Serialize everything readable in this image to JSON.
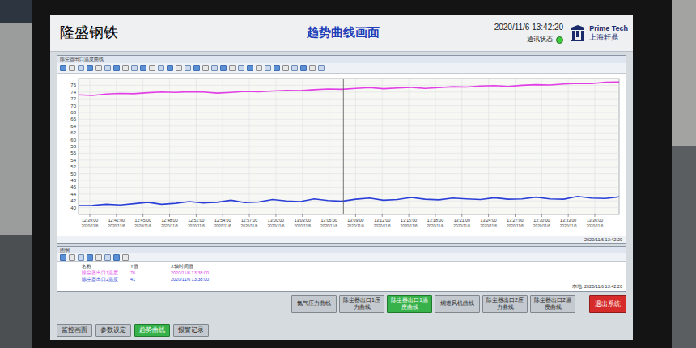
{
  "header": {
    "company": "隆盛钢铁",
    "title": "趋势曲线画面",
    "datetime": "2020/11/6 13:42:20",
    "comm_label": "通讯状态",
    "comm_ok": true,
    "logo": {
      "brand": "Prime Tech",
      "name": "上海轩鼎"
    }
  },
  "chart": {
    "window_title": "除尘器出口温度曲线",
    "y_ticks": [
      "76",
      "74",
      "72",
      "70",
      "68",
      "66",
      "64",
      "62",
      "60",
      "58",
      "56",
      "54",
      "52",
      "50",
      "48",
      "46",
      "44",
      "42",
      "40"
    ],
    "x_ticks": [
      {
        "time": "12:39:00",
        "date": "2020/11/6"
      },
      {
        "time": "12:42:00",
        "date": "2020/11/6"
      },
      {
        "time": "12:45:00",
        "date": "2020/11/6"
      },
      {
        "time": "12:48:00",
        "date": "2020/11/6"
      },
      {
        "time": "12:51:00",
        "date": "2020/11/6"
      },
      {
        "time": "12:54:00",
        "date": "2020/11/6"
      },
      {
        "time": "12:57:00",
        "date": "2020/11/6"
      },
      {
        "time": "13:00:00",
        "date": "2020/11/6"
      },
      {
        "time": "13:03:00",
        "date": "2020/11/6"
      },
      {
        "time": "13:06:00",
        "date": "2020/11/6"
      },
      {
        "time": "13:09:00",
        "date": "2020/11/6"
      },
      {
        "time": "13:12:00",
        "date": "2020/11/6"
      },
      {
        "time": "13:15:00",
        "date": "2020/11/6"
      },
      {
        "time": "13:18:00",
        "date": "2020/11/6"
      },
      {
        "time": "13:21:00",
        "date": "2020/11/6"
      },
      {
        "time": "13:24:00",
        "date": "2020/11/6"
      },
      {
        "time": "13:27:00",
        "date": "2020/11/6"
      },
      {
        "time": "13:30:00",
        "date": "2020/11/6"
      },
      {
        "time": "13:33:00",
        "date": "2020/11/6"
      },
      {
        "time": "13:36:00",
        "date": "2020/11/6"
      }
    ],
    "series": [
      {
        "color": "#e23ee6",
        "values": [
          73.2,
          73.0,
          73.4,
          73.6,
          73.5,
          73.8,
          74.0,
          73.9,
          74.1,
          74.0,
          73.7,
          73.9,
          74.2,
          74.1,
          74.3,
          74.5,
          74.4,
          74.7,
          74.9,
          74.8,
          75.1,
          75.3,
          75.0,
          75.2,
          75.4,
          75.1,
          75.3,
          75.6,
          75.5,
          75.8,
          75.9,
          75.7,
          76.0,
          76.2,
          76.1,
          76.4,
          76.6,
          76.5,
          76.9,
          77.0
        ]
      },
      {
        "color": "#2a3fd8",
        "values": [
          40.6,
          40.7,
          41.0,
          40.8,
          41.2,
          41.6,
          41.0,
          41.3,
          41.8,
          41.4,
          41.6,
          42.2,
          41.5,
          41.7,
          42.4,
          42.0,
          41.8,
          42.6,
          42.1,
          41.9,
          42.5,
          42.8,
          42.2,
          42.4,
          43.0,
          42.5,
          42.3,
          42.8,
          42.6,
          42.4,
          42.9,
          42.5,
          42.6,
          43.1,
          42.6,
          42.5,
          43.3,
          42.8,
          42.7,
          43.2
        ]
      }
    ],
    "cursor": {
      "level": 0.49
    },
    "status_time": "2020/11/6 13:42:20"
  },
  "legend": {
    "title": "图例",
    "columns": [
      "名称",
      "Y值",
      "X轴时间值"
    ],
    "rows": [
      {
        "name": "除尘器出口1温度",
        "value": "76",
        "time": "2020/11/6 13:38:00",
        "color": "#e23ee6"
      },
      {
        "name": "除尘器出口2温度",
        "value": "41",
        "time": "2020/11/6 13:38:00",
        "color": "#2a3fd8"
      }
    ],
    "local_time": "本地: 2020/11/6 13:42:20"
  },
  "curve_buttons": [
    {
      "label": "氮气压力曲线",
      "selected": false
    },
    {
      "label": "除尘器出口1压力曲线",
      "selected": false
    },
    {
      "label": "除尘器出口1温度曲线",
      "selected": true
    },
    {
      "label": "烟道风机曲线",
      "selected": false
    },
    {
      "label": "除尘器出口2压力曲线",
      "selected": false
    },
    {
      "label": "除尘器出口2温度曲线",
      "selected": false
    }
  ],
  "exit_button": "退出系统",
  "nav": [
    {
      "label": "监控画面",
      "selected": false
    },
    {
      "label": "参数设定",
      "selected": false
    },
    {
      "label": "趋势曲线",
      "selected": true
    },
    {
      "label": "报警记录",
      "selected": false
    }
  ]
}
